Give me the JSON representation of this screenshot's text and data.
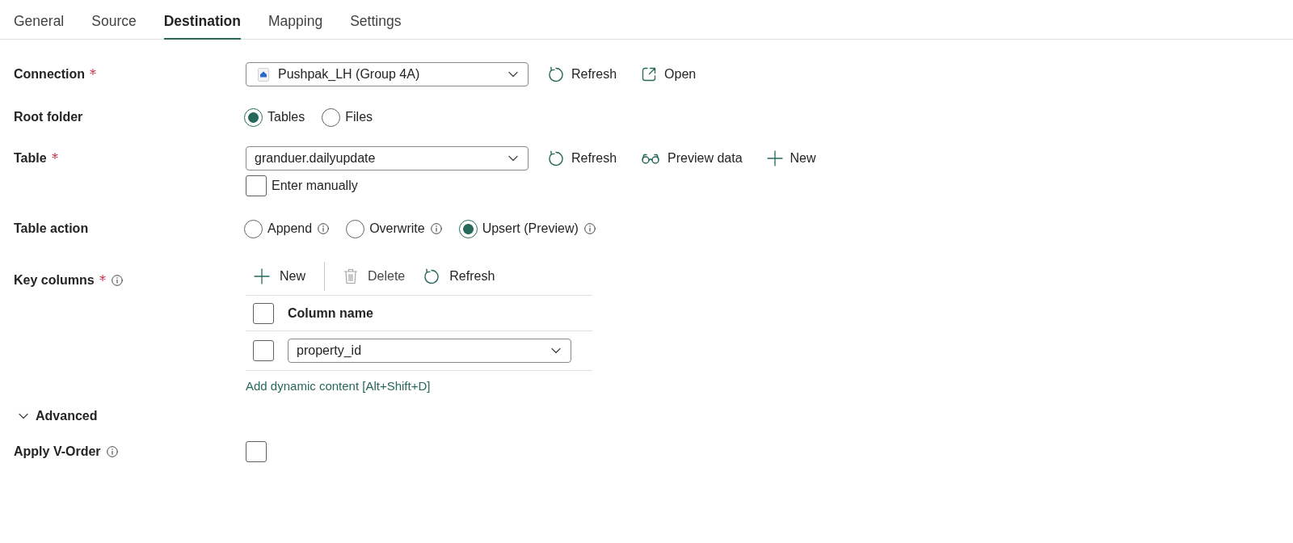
{
  "tabs": [
    {
      "label": "General",
      "selected": false
    },
    {
      "label": "Source",
      "selected": false
    },
    {
      "label": "Destination",
      "selected": true
    },
    {
      "label": "Mapping",
      "selected": false
    },
    {
      "label": "Settings",
      "selected": false
    }
  ],
  "fields": [
    {
      "kind": "connection",
      "label": "Connection",
      "required": true,
      "value": "Pushpak_LH (Group 4A)",
      "actions": [
        {
          "kind": "refresh",
          "label": "Refresh"
        },
        {
          "kind": "open",
          "label": "Open"
        }
      ]
    },
    {
      "kind": "radio",
      "label": "Root folder",
      "required": false,
      "options": [
        {
          "label": "Tables",
          "selected": true
        },
        {
          "label": "Files",
          "selected": false
        }
      ]
    },
    {
      "kind": "table",
      "label": "Table",
      "required": true,
      "value": "granduer.dailyupdate",
      "actions": [
        {
          "kind": "refresh",
          "label": "Refresh"
        },
        {
          "kind": "preview",
          "label": "Preview data"
        },
        {
          "kind": "new",
          "label": "New"
        }
      ],
      "manual": {
        "label": "Enter manually",
        "checked": false
      }
    },
    {
      "kind": "radio",
      "label": "Table action",
      "required": false,
      "options": [
        {
          "label": "Append",
          "selected": false,
          "info": true
        },
        {
          "label": "Overwrite",
          "selected": false,
          "info": true
        },
        {
          "label": "Upsert (Preview)",
          "selected": true,
          "info": true
        }
      ]
    },
    {
      "kind": "key_columns",
      "label": "Key columns",
      "required": true,
      "info": true,
      "toolbar": [
        {
          "kind": "new",
          "label": "New",
          "disabled": false
        },
        {
          "kind": "delete",
          "label": "Delete",
          "disabled": true
        },
        {
          "kind": "refresh",
          "label": "Refresh",
          "disabled": false
        }
      ],
      "columns": [
        {
          "label": "Column name"
        }
      ],
      "all_checked": false,
      "rows": [
        {
          "checked": false,
          "value": "property_id"
        }
      ],
      "link": "Add dynamic content [Alt+Shift+D]"
    }
  ],
  "advanced": {
    "label": "Advanced",
    "expanded": true,
    "fields": [
      {
        "kind": "checkbox",
        "label": "Apply V-Order",
        "info": true,
        "checked": false
      }
    ]
  }
}
